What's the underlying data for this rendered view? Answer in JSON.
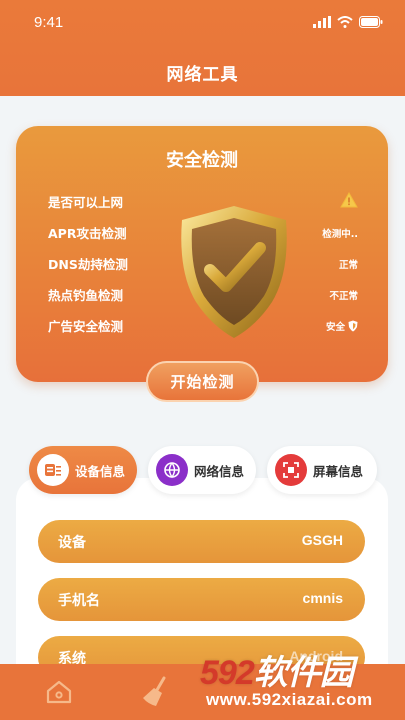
{
  "status_bar": {
    "time": "9:41"
  },
  "header": {
    "title": "网络工具"
  },
  "security_check": {
    "title": "安全检测",
    "rows": [
      {
        "label": "是否可以上网",
        "status": "",
        "status_icon": "warning-icon"
      },
      {
        "label": "APR攻击检测",
        "status": "检测中..",
        "status_icon": ""
      },
      {
        "label": "DNS劫持检测",
        "status": "正常",
        "status_icon": ""
      },
      {
        "label": "热点钓鱼检测",
        "status": "不正常",
        "status_icon": ""
      },
      {
        "label": "广告安全检测",
        "status": "安全",
        "status_icon": "shield-icon"
      }
    ],
    "start_button": "开始检测"
  },
  "tabs": [
    {
      "label": "设备信息",
      "icon": "device-info-icon",
      "active": true
    },
    {
      "label": "网络信息",
      "icon": "network-info-icon",
      "active": false
    },
    {
      "label": "屏幕信息",
      "icon": "screen-info-icon",
      "active": false
    }
  ],
  "device_info": [
    {
      "key": "设备",
      "value": "GSGH"
    },
    {
      "key": "手机名",
      "value": "cmnis"
    },
    {
      "key": "系统",
      "value": "Android"
    }
  ],
  "bottom_nav": [
    {
      "icon": "home-icon"
    },
    {
      "icon": "clean-broom-icon"
    }
  ],
  "watermark": {
    "brand": "592软件园",
    "url": "www.592xiazai.com"
  },
  "colors": {
    "accent": "#e8743a",
    "card_orange": "#e99a3d",
    "row_orange": "#ecab44"
  }
}
